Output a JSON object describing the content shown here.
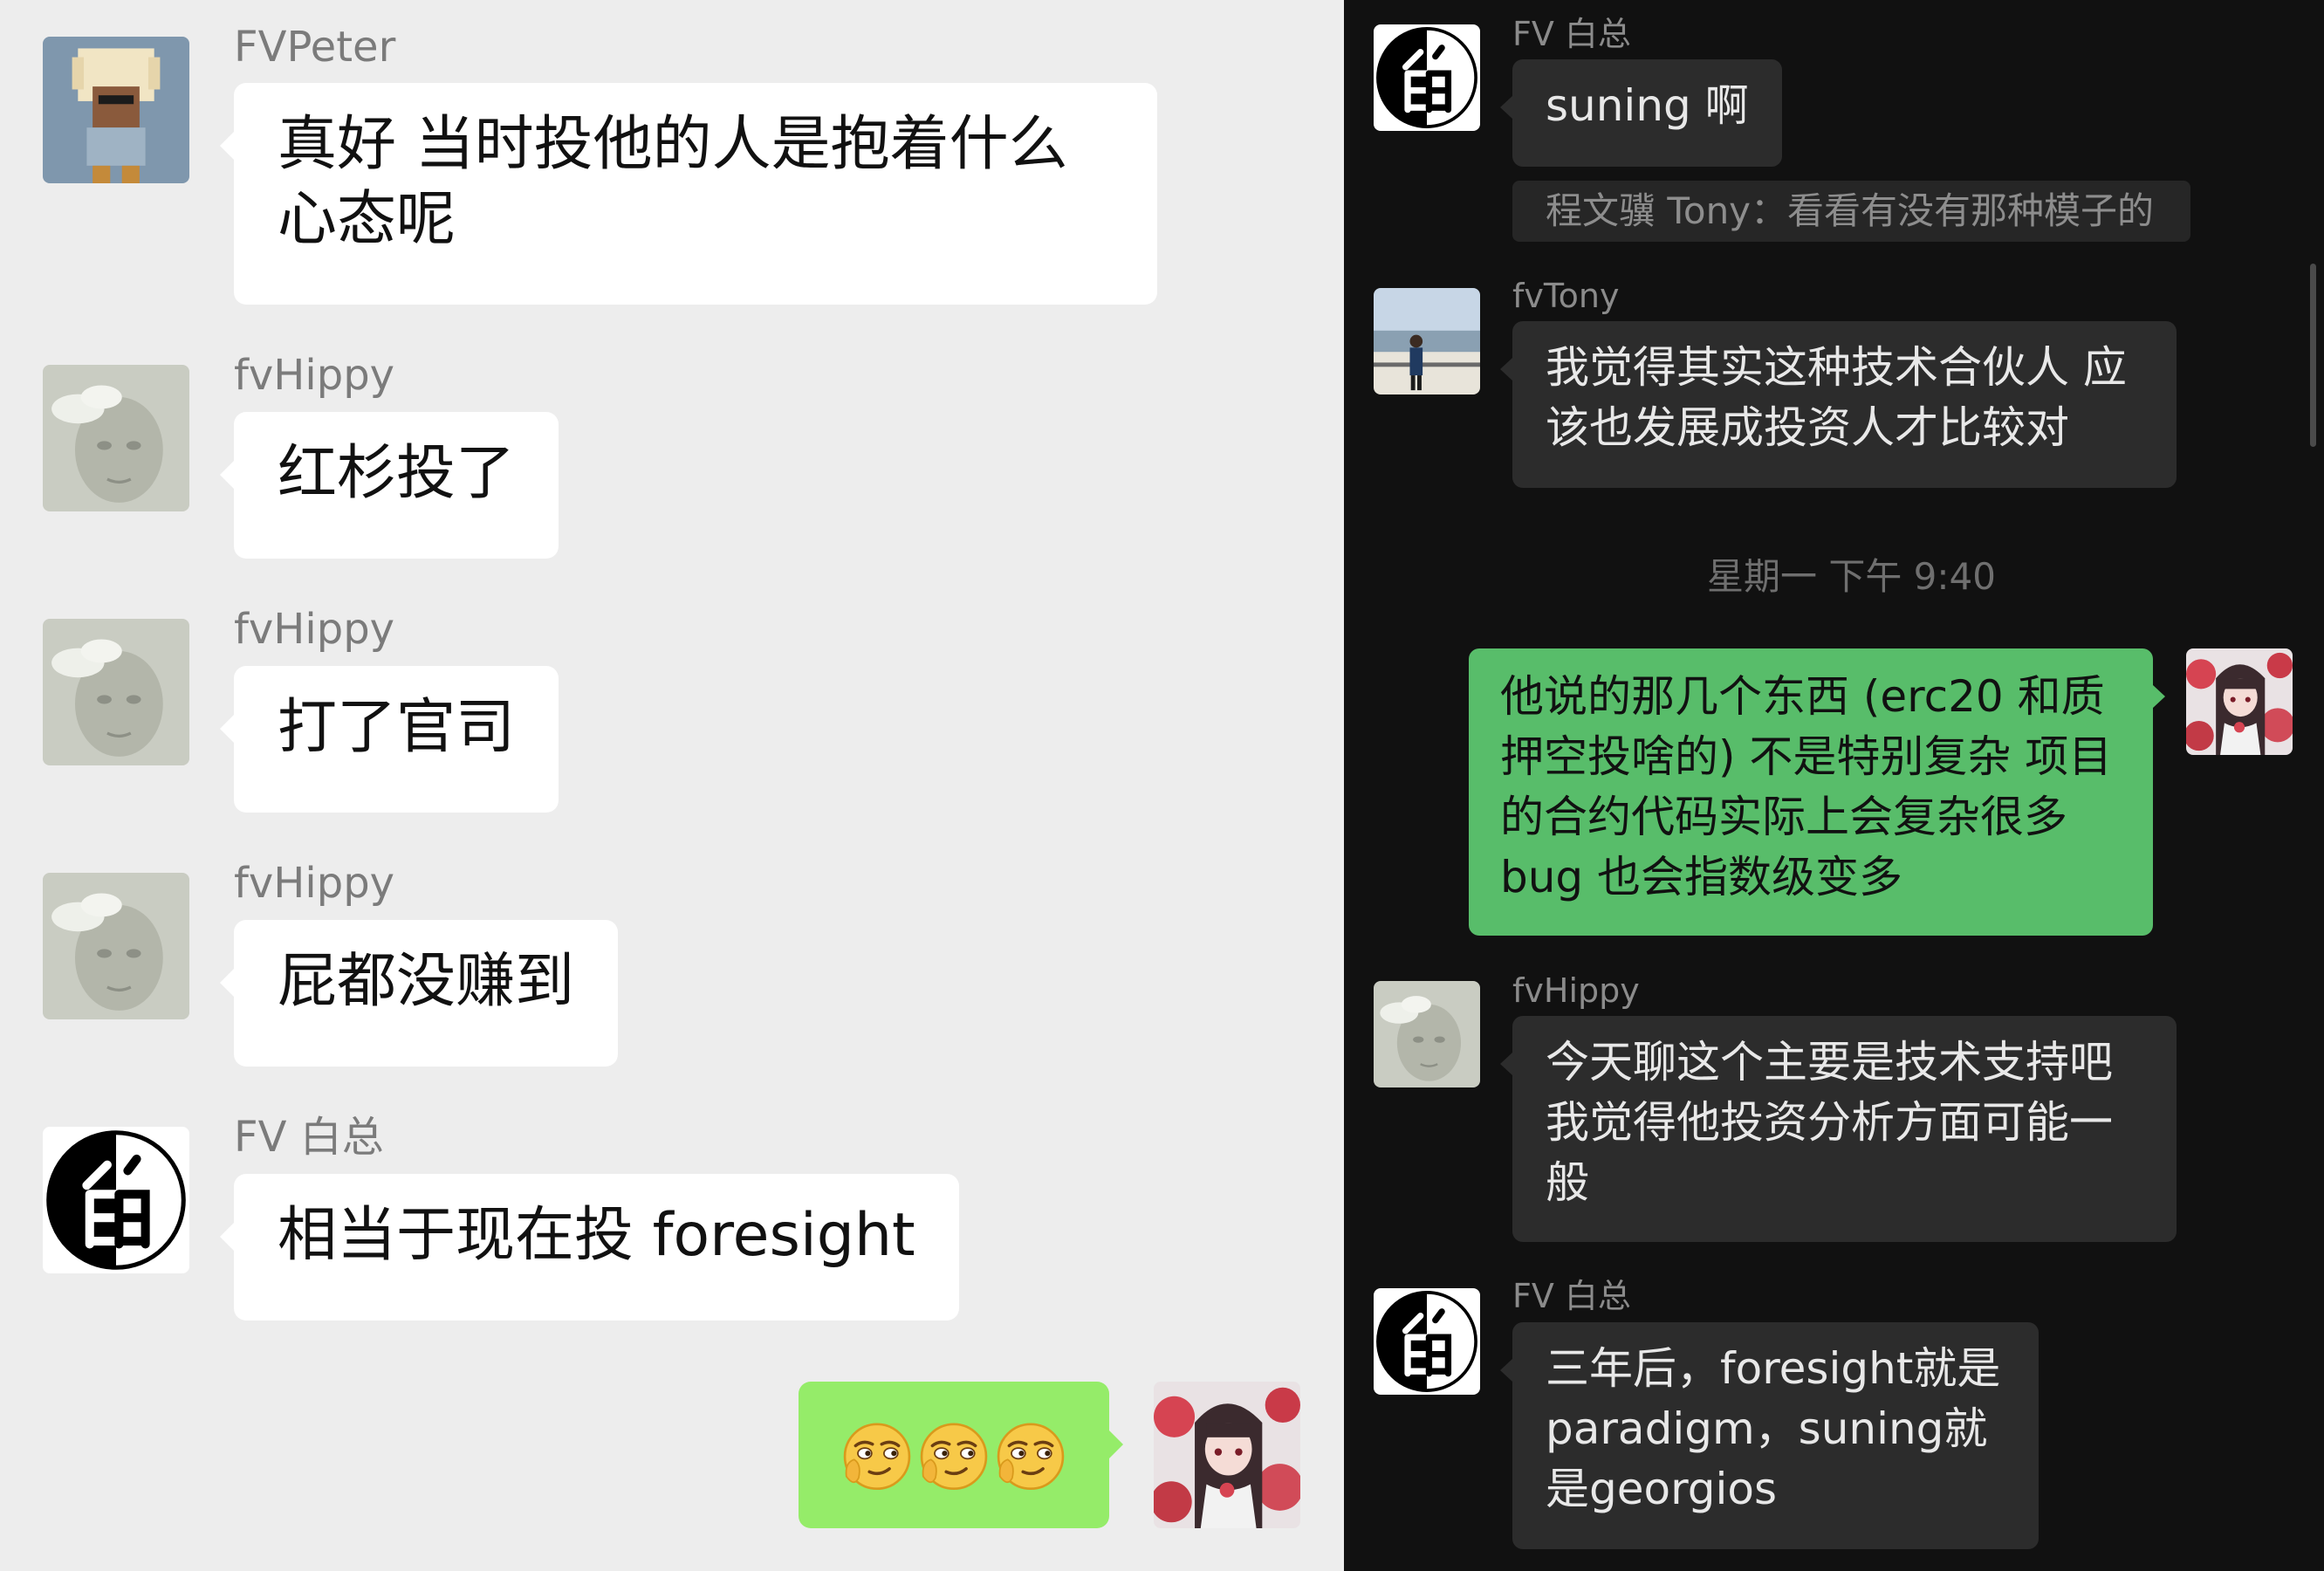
{
  "left_chat": {
    "messages": [
      {
        "sender": "FVPeter",
        "text": "真好  当时投他的人是抱着什么心态呢",
        "avatar": "voxel-person-avatar"
      },
      {
        "sender": "fvHippy",
        "text": "红杉投了",
        "avatar": "portrait-avatar"
      },
      {
        "sender": "fvHippy",
        "text": "打了官司",
        "avatar": "portrait-avatar"
      },
      {
        "sender": "fvHippy",
        "text": "屁都没赚到",
        "avatar": "portrait-avatar"
      },
      {
        "sender": "FV 白总",
        "text": "相当于现在投 foresight",
        "avatar": "bai-logo-avatar"
      }
    ],
    "my_message": {
      "content": "smirk-emoji x3",
      "count": 3,
      "avatar": "anime-girl-avatar"
    }
  },
  "right_chat": {
    "messages": [
      {
        "sender": "FV 白总",
        "text": "suning 啊",
        "avatar": "bai-logo-avatar"
      },
      {
        "sender": "fvTony",
        "text": "我觉得其实这种技术合伙人 应该也发展成投资人才比较对",
        "avatar": "photo-person-avatar"
      },
      {
        "sender": "fvHippy",
        "text": "今天聊这个主要是技术支持吧 我觉得他投资分析方面可能一般",
        "avatar": "portrait-avatar"
      },
      {
        "sender": "FV 白总",
        "text": "三年后，foresight就是paradigm，suning就是georgios",
        "avatar": "bai-logo-avatar"
      }
    ],
    "quote": "程文骥 Tony：看看有没有那种模子的",
    "timestamp": "星期一 下午 9:40",
    "my_message": {
      "text": "他说的那几个东西 (erc20 和质押空投啥的) 不是特别复杂 项目的合约代码实际上会复杂很多 bug 也会指数级变多",
      "avatar": "anime-girl-avatar"
    }
  },
  "colors": {
    "left_bg": "#ededed",
    "right_bg": "#111111",
    "my_bubble_light": "#95ec69",
    "my_bubble_dark": "#58bd6a",
    "their_bubble_light": "#ffffff",
    "their_bubble_dark": "#2c2c2c"
  }
}
